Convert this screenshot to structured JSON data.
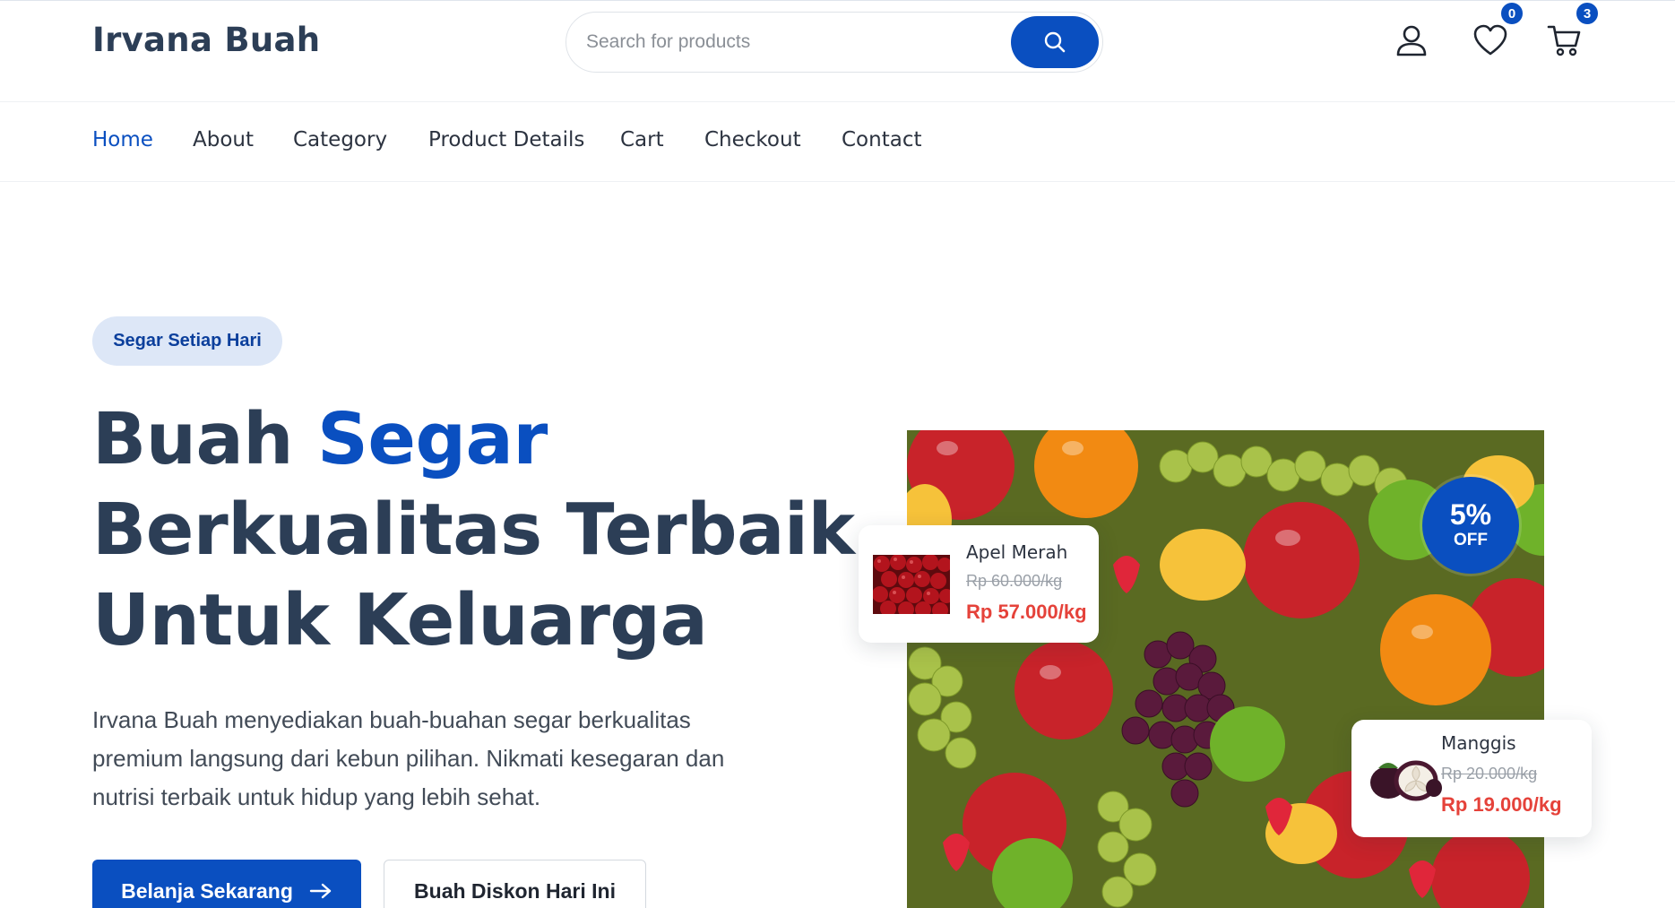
{
  "header": {
    "brand": "Irvana Buah",
    "search": {
      "placeholder": "Search for products",
      "value": ""
    },
    "icons": [
      "user-icon",
      "heart-icon",
      "cart-icon"
    ],
    "wishlist_count": "0",
    "cart_count": "3"
  },
  "nav": {
    "items": [
      {
        "label": "Home",
        "active": true
      },
      {
        "label": "About"
      },
      {
        "label": "Category"
      },
      {
        "label": "Product Details"
      },
      {
        "label": "Cart"
      },
      {
        "label": "Checkout"
      },
      {
        "label": "Contact"
      }
    ]
  },
  "hero": {
    "tag": "Segar Setiap Hari",
    "headline": {
      "line1_plain": "Buah ",
      "line1_accent": "Segar",
      "line2": "Berkualitas Terbaik",
      "line3": "Untuk Keluarga"
    },
    "description": "Irvana Buah menyediakan buah-buahan segar berkualitas premium langsung dari kebun pilihan. Nikmati kesegaran dan nutrisi terbaik untuk hidup yang lebih sehat.",
    "primary_button": "Belanja Sekarang",
    "secondary_button": "Buah Diskon Hari Ini",
    "discount": {
      "percent": "5%",
      "label": "OFF"
    },
    "products": [
      {
        "name": "Apel Merah",
        "old_price": "Rp 60.000/kg",
        "new_price": "Rp 57.000/kg"
      },
      {
        "name": "Manggis",
        "old_price": "Rp 20.000/kg",
        "new_price": "Rp 19.000/kg"
      }
    ]
  },
  "colors": {
    "brand_blue": "#0a4fc0",
    "heading": "#2c3e56",
    "sale_red": "#e5423a",
    "pill_bg": "#dde7f7"
  }
}
